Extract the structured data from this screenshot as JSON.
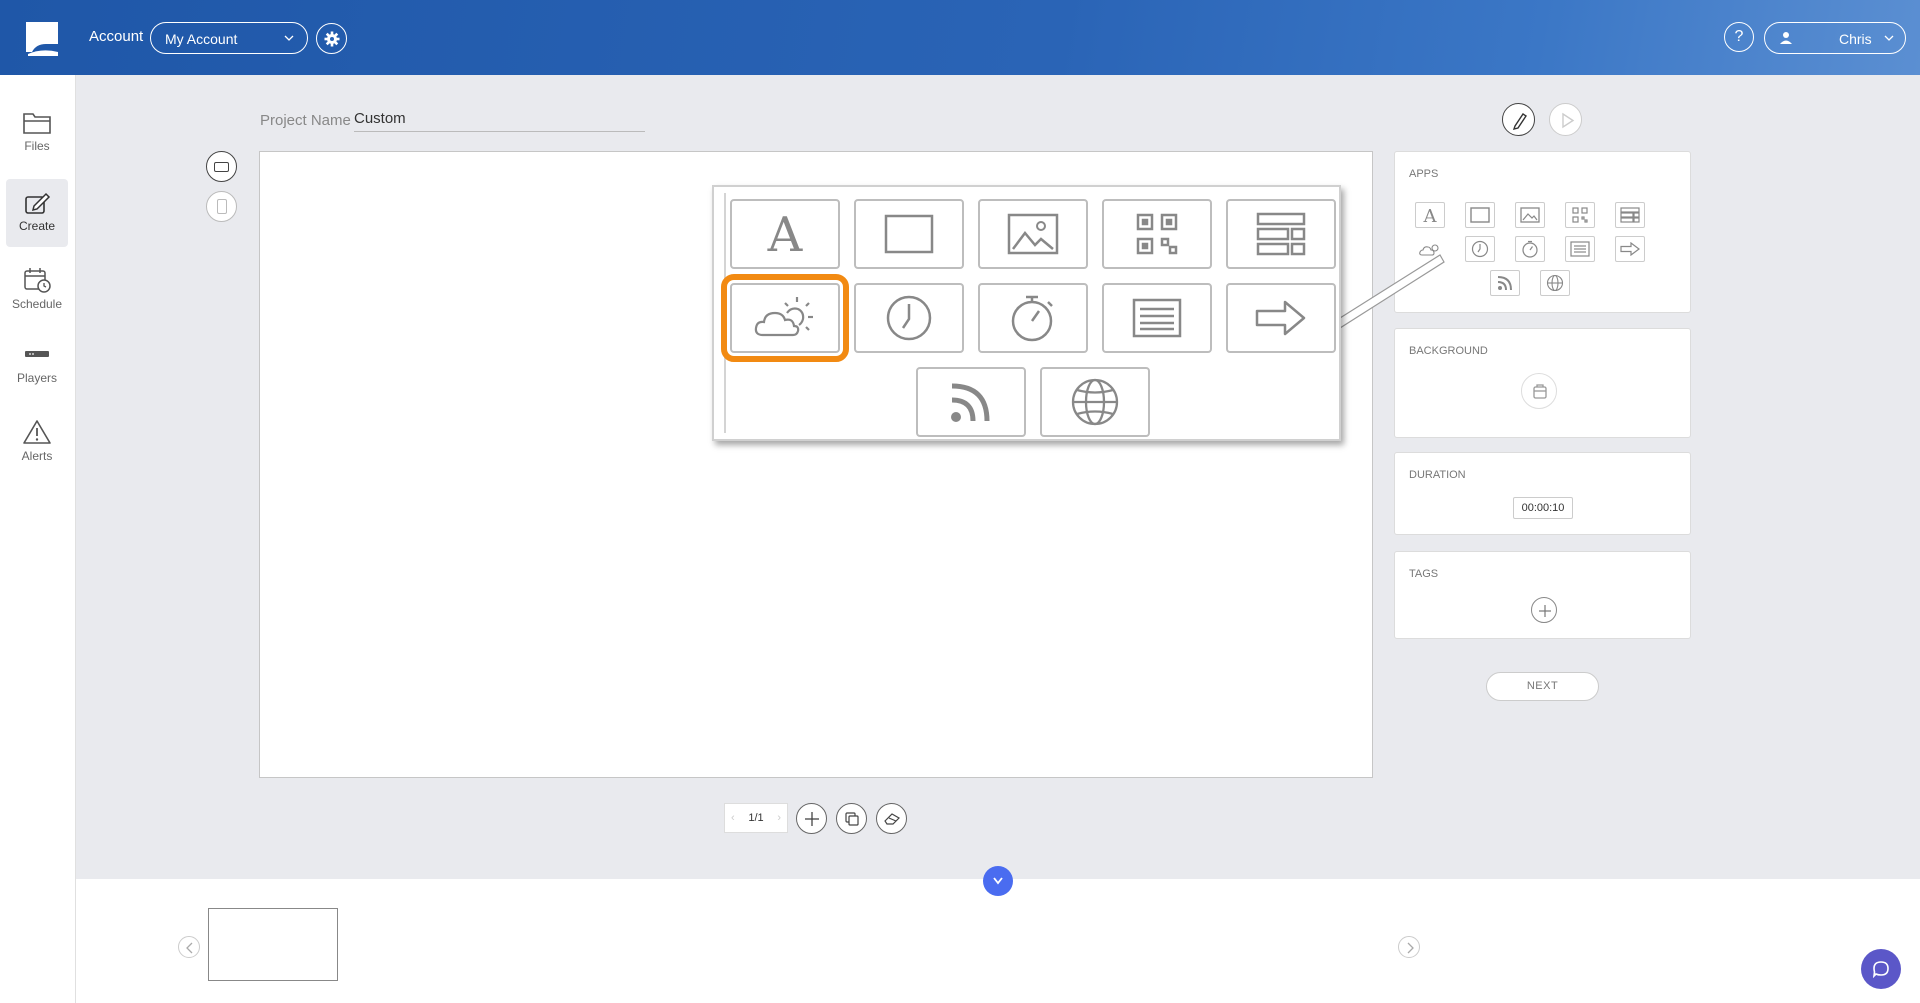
{
  "header": {
    "account_label": "Account",
    "account_select": "My Account",
    "help_label": "?",
    "user_name": "Chris"
  },
  "sidebar": {
    "items": [
      {
        "label": "Files",
        "icon": "folder-icon"
      },
      {
        "label": "Create",
        "icon": "create-icon",
        "active": true
      },
      {
        "label": "Schedule",
        "icon": "schedule-icon"
      },
      {
        "label": "Players",
        "icon": "player-icon"
      },
      {
        "label": "Alerts",
        "icon": "alert-icon"
      }
    ]
  },
  "project": {
    "name_label": "Project Name",
    "name_value": "Custom"
  },
  "panels": {
    "apps_title": "APPS",
    "apps": [
      "text-icon",
      "shape-icon",
      "image-icon",
      "qr-icon",
      "list-layout-icon",
      "weather-icon",
      "clock-icon",
      "timer-icon",
      "news-icon",
      "arrow-icon",
      "rss-icon",
      "web-icon"
    ],
    "background_title": "BACKGROUND",
    "duration_title": "DURATION",
    "duration_value": "00:00:10",
    "tags_title": "TAGS",
    "next_label": "NEXT"
  },
  "pager": {
    "indicator": "1/1"
  },
  "colors": {
    "header": "#2a64b6",
    "highlight": "#f28a12",
    "expand": "#4a6cf0",
    "chat": "#5b57c8"
  }
}
